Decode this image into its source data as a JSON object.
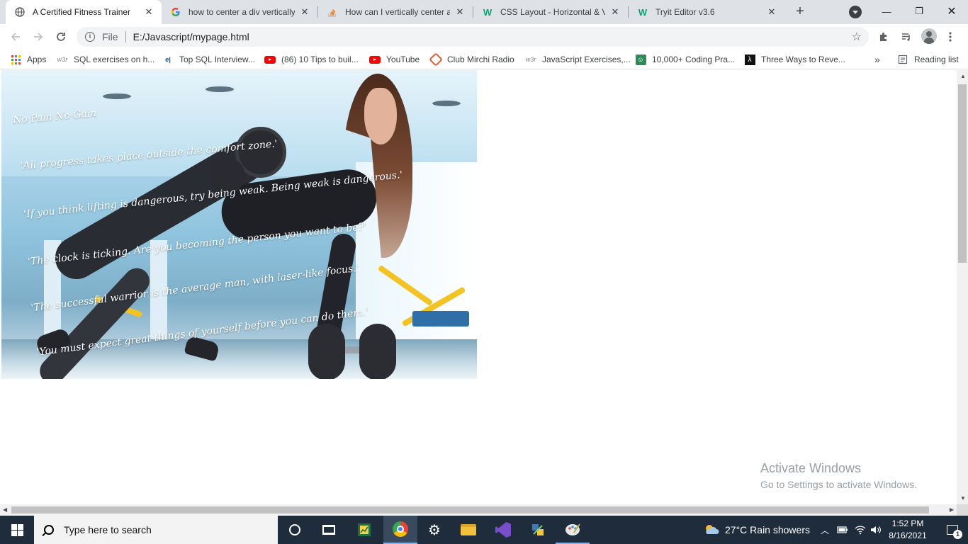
{
  "window": {
    "tabs": [
      {
        "title": "A Certified Fitness Trainer",
        "favicon": "globe-icon",
        "active": true
      },
      {
        "title": "how to center a div vertically",
        "favicon": "google-icon",
        "active": false
      },
      {
        "title": "How can I vertically center a",
        "favicon": "stackoverflow-icon",
        "active": false
      },
      {
        "title": "CSS Layout - Horizontal & Ve",
        "favicon": "w3schools-icon",
        "active": false
      },
      {
        "title": "Tryit Editor v3.6",
        "favicon": "w3schools-icon",
        "active": false
      }
    ],
    "controls": {
      "minimize": "—",
      "restore": "❐",
      "close": "✕"
    }
  },
  "toolbar": {
    "scheme_label": "File",
    "url": "E:/Javascript/mypage.html"
  },
  "bookmarks": {
    "items": [
      {
        "label": "Apps",
        "icon": "apps-grid-icon"
      },
      {
        "label": "SQL exercises on h...",
        "icon": "w3resource-icon"
      },
      {
        "label": "Top SQL Interview...",
        "icon": "edureka-icon"
      },
      {
        "label": "(86) 10 Tips to buil...",
        "icon": "youtube-icon"
      },
      {
        "label": "YouTube",
        "icon": "youtube-icon"
      },
      {
        "label": "Club Mirchi Radio",
        "icon": "mirchi-icon"
      },
      {
        "label": "JavaScript Exercises,...",
        "icon": "w3resource-icon"
      },
      {
        "label": "10,000+ Coding Pra...",
        "icon": "coding-icon"
      },
      {
        "label": "Three Ways to Reve...",
        "icon": "freecodecamp-icon"
      }
    ],
    "overflow": "»",
    "reading_list": "Reading list"
  },
  "page": {
    "quotes": [
      "No Pain No Gain",
      "'All progress takes place outside the comfort zone.'",
      "'If you think lifting is dangerous, try being weak. Being weak is dangerous.'",
      "'The clock is ticking. Are you becoming the person you want to be?'",
      "'The successful warrior is the average man, with laser-like focus.'",
      "'You must expect great things of yourself before you can do them.'"
    ]
  },
  "watermark": {
    "line1": "Activate Windows",
    "line2": "Go to Settings to activate Windows."
  },
  "taskbar": {
    "search_placeholder": "Type here to search",
    "weather": "27°C  Rain showers",
    "time": "1:52 PM",
    "date": "8/16/2021",
    "notification_count": "1"
  }
}
